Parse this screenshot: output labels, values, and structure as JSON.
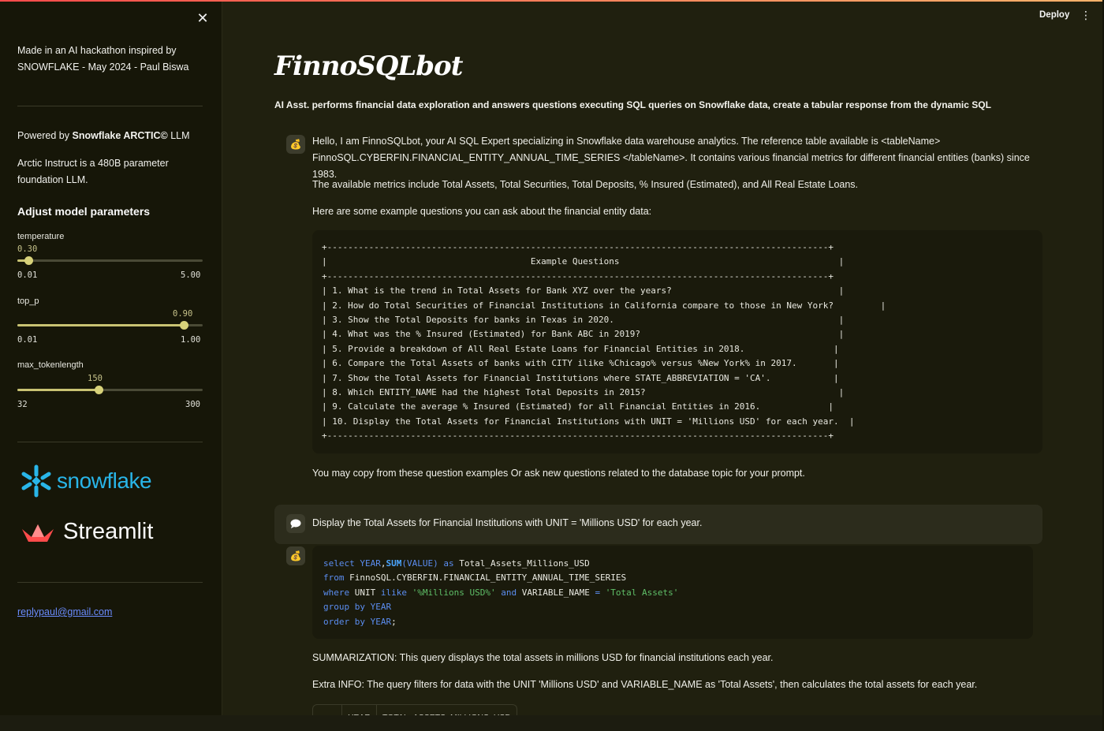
{
  "sidebar": {
    "intro": "Made in an AI hackathon inspired by SNOWFLAKE - May 2024 - Paul Biswa",
    "powered_by_prefix": "Powered by ",
    "powered_by_bold": "Snowflake ARCTIC©",
    "powered_by_suffix": " LLM",
    "arctic_desc": "Arctic Instruct is a 480B parameter foundation LLM.",
    "params_heading": "Adjust model parameters",
    "sliders": [
      {
        "label": "temperature",
        "value": "0.30",
        "min": "0.01",
        "max": "5.00",
        "fraction": 0.06
      },
      {
        "label": "top_p",
        "value": "0.90",
        "min": "0.01",
        "max": "1.00",
        "fraction": 0.899
      },
      {
        "label": "max_tokenlength",
        "value": "150",
        "min": "32",
        "max": "300",
        "fraction": 0.44
      }
    ],
    "snowflake_logo": "snowflake",
    "streamlit_logo": "Streamlit",
    "email": "replypaul@gmail.com"
  },
  "header": {
    "deploy": "Deploy",
    "menu_icon": "⋮"
  },
  "main": {
    "title": "FinnoSQLbot",
    "subtitle": "AI Asst. performs financial data exploration and answers questions executing SQL queries on Snowflake data, create a tabular response from the dynamic SQL",
    "assistant_intro": "Hello, I am FinnoSQLbot, your AI SQL Expert specializing in Snowflake data warehouse analytics. The reference table available is <tableName> FinnoSQL.CYBERFIN.FINANCIAL_ENTITY_ANNUAL_TIME_SERIES </tableName>. It contains various financial metrics for different financial entities (banks) since 1983.",
    "metrics_text": "The available metrics include Total Assets, Total Securities, Total Deposits, % Insured (Estimated), and All Real Estate Loans.",
    "examples_intro": "Here are some example questions you can ask about the financial entity data:",
    "example_questions_block": "+------------------------------------------------------------------------------------------------+\n|                                       Example Questions                                          |\n+------------------------------------------------------------------------------------------------+\n| 1. What is the trend in Total Assets for Bank XYZ over the years?                                |\n| 2. How do Total Securities of Financial Institutions in California compare to those in New York?         |\n| 3. Show the Total Deposits for banks in Texas in 2020.                                           |\n| 4. What was the % Insured (Estimated) for Bank ABC in 2019?                                      |\n| 5. Provide a breakdown of All Real Estate Loans for Financial Entities in 2018.                 |\n| 6. Compare the Total Assets of banks with CITY ilike %Chicago% versus %New York% in 2017.       |\n| 7. Show the Total Assets for Financial Institutions where STATE_ABBREVIATION = 'CA'.            |\n| 8. Which ENTITY_NAME had the highest Total Deposits in 2015?                                     |\n| 9. Calculate the average % Insured (Estimated) for all Financial Entities in 2016.             |\n| 10. Display the Total Assets for Financial Institutions with UNIT = 'Millions USD' for each year.  |\n+------------------------------------------------------------------------------------------------+",
    "copy_hint": "You may copy from these question examples Or ask new questions related to the database topic for your prompt.",
    "user_question": "Display the Total Assets for Financial Institutions with UNIT = 'Millions USD' for each year.",
    "sql_lines": [
      [
        [
          "kw",
          "select "
        ],
        [
          "kw",
          "YEAR"
        ],
        [
          "",
          ","
        ],
        [
          "fn",
          "SUM"
        ],
        [
          "kw",
          "(VALUE)"
        ],
        [
          "kw",
          " as "
        ],
        [
          "",
          "Total_Assets_Millions_USD"
        ]
      ],
      [
        [
          "kw",
          "from "
        ],
        [
          "",
          "FinnoSQL.CYBERFIN.FINANCIAL_ENTITY_ANNUAL_TIME_SERIES"
        ]
      ],
      [
        [
          "kw",
          "where "
        ],
        [
          "",
          "UNIT "
        ],
        [
          "kw",
          "ilike "
        ],
        [
          "str",
          "'%Millions USD%'"
        ],
        [
          "kw",
          " and "
        ],
        [
          "",
          "VARIABLE_NAME "
        ],
        [
          "kw",
          "= "
        ],
        [
          "str",
          "'Total Assets'"
        ]
      ],
      [
        [
          "kw",
          "group by YEAR"
        ]
      ],
      [
        [
          "kw",
          "order by YEAR"
        ],
        [
          "",
          ";"
        ]
      ]
    ],
    "summarization": "SUMMARIZATION: This query displays the total assets in millions USD for financial institutions each year.",
    "extra_info": "Extra INFO: The query filters for data with the UNIT 'Millions USD' and VARIABLE_NAME as 'Total Assets', then calculates the total assets for each year.",
    "table_headers": [
      "",
      "YEAR",
      "TOTAL_ASSETS_MILLIONS_USD"
    ]
  },
  "colors": {
    "background": "#20200f",
    "sidebar": "#161608",
    "accent": "#c9c373",
    "link": "#6a8cff",
    "snowflake_blue": "#29b5e8",
    "streamlit_red": "#ff4b4b"
  }
}
